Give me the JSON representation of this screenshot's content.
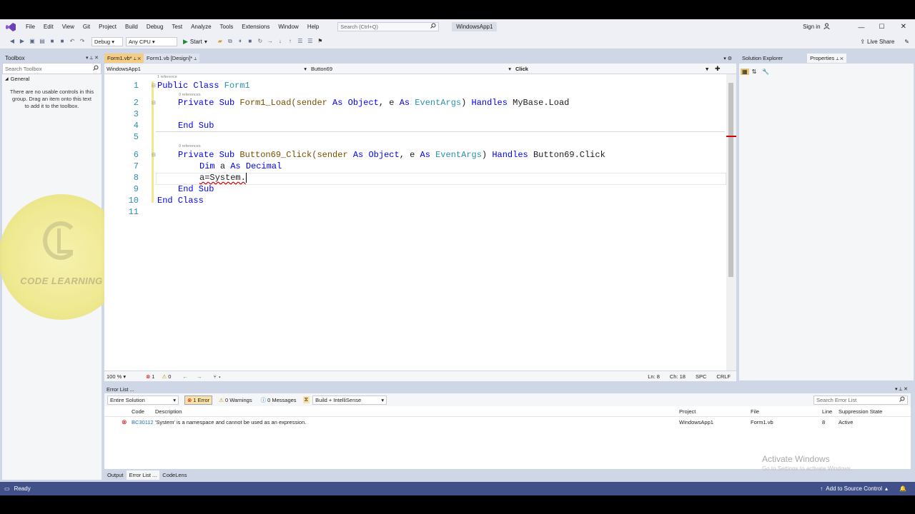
{
  "menu": {
    "items": [
      "File",
      "Edit",
      "View",
      "Git",
      "Project",
      "Build",
      "Debug",
      "Test",
      "Analyze",
      "Tools",
      "Extensions",
      "Window",
      "Help"
    ],
    "search_placeholder": "Search (Ctrl+Q)",
    "solution_title": "WindowsApp1",
    "sign_in": "Sign in",
    "live_share": "Live Share"
  },
  "toolbar": {
    "config": "Debug",
    "platform": "Any CPU",
    "start": "Start"
  },
  "toolbox": {
    "title": "Toolbox",
    "search_placeholder": "Search Toolbox",
    "group": "General",
    "empty_message": "There are no usable controls in this group. Drag an item onto this text to add it to the toolbox."
  },
  "editor": {
    "tabs": [
      "Form1.vb*",
      "Form1.vb [Design]*"
    ],
    "nav": {
      "project": "WindowsApp1",
      "object": "Button69",
      "member": "Click"
    },
    "hints": {
      "ref1": "1 reference",
      "ref0": "0 references"
    },
    "line_numbers": [
      "1",
      "2",
      "3",
      "4",
      "5",
      "6",
      "7",
      "8",
      "9",
      "10",
      "11"
    ],
    "code": {
      "l1_kw": "Public Class",
      "l1_name": "Form1",
      "l2_kw": "Private Sub",
      "l2_name": "Form1_Load(sender",
      "l2_as1": "As",
      "l2_obj": "Object",
      "l2_e": ", e",
      "l2_as2": "As",
      "l2_type": "EventArgs",
      "l2_close": ")",
      "l2_handles": "Handles",
      "l2_mybase": "MyBase.Load",
      "l4": "End Sub",
      "l6_kw": "Private Sub",
      "l6_name": "Button69_Click(sender",
      "l6_as1": "As",
      "l6_obj": "Object",
      "l6_e": ", e",
      "l6_as2": "As",
      "l6_type": "EventArgs",
      "l6_close": ")",
      "l6_handles": "Handles",
      "l6_target": "Button69.Click",
      "l7_dim": "Dim",
      "l7_var": "a",
      "l7_as": "As",
      "l7_type": "Decimal",
      "l8": "a=System.",
      "l9": "End Sub",
      "l10": "End Class"
    },
    "status": {
      "zoom": "100 %",
      "errors": "1",
      "warnings": "0",
      "ln": "Ln: 8",
      "ch": "Ch: 18",
      "spc": "SPC",
      "eol": "CRLF"
    }
  },
  "solution_explorer": {
    "title": "Solution Explorer"
  },
  "properties": {
    "title": "Properties"
  },
  "watermark": {
    "text": "CODE LEARNING"
  },
  "error_list": {
    "title": "Error List ...",
    "scope": "Entire Solution",
    "errors_btn": "1 Error",
    "warnings_btn": "0 Warnings",
    "messages_btn": "0 Messages",
    "build_filter": "Build + IntelliSense",
    "search_placeholder": "Search Error List",
    "columns": [
      "Code",
      "Description",
      "Project",
      "File",
      "Line",
      "Suppression State"
    ],
    "rows": [
      {
        "code": "BC30112",
        "description": "'System' is a namespace and cannot be used as an expression.",
        "project": "WindowsApp1",
        "file": "Form1.vb",
        "line": "8",
        "state": "Active"
      }
    ],
    "bottom_tabs": [
      "Output",
      "Error List ...",
      "CodeLens"
    ]
  },
  "activate": {
    "title": "Activate Windows",
    "subtitle": "Go to Settings to activate Windows."
  },
  "statusbar": {
    "ready": "Ready",
    "source_control": "Add to Source Control"
  }
}
